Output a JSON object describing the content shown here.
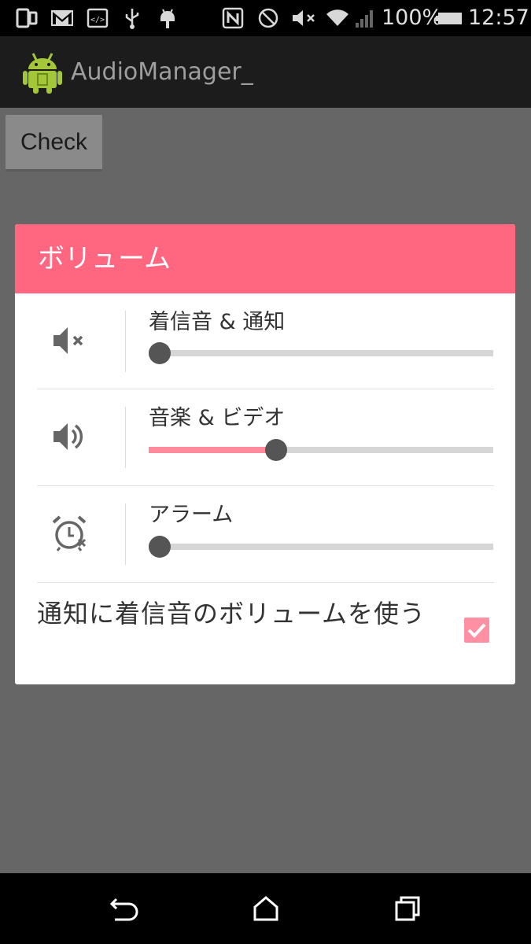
{
  "status_bar": {
    "battery_percent": "100%",
    "time": "12:57",
    "icons": [
      "tablet-icon",
      "gmail-icon",
      "code-icon",
      "usb-icon",
      "android-debug-icon",
      "nfc-icon",
      "block-icon",
      "mute-icon",
      "wifi-icon",
      "signal-icon",
      "battery-icon"
    ]
  },
  "action_bar": {
    "app_title": "AudioManager_",
    "app_icon": "android-app-icon"
  },
  "main": {
    "check_button": "Check"
  },
  "dialog": {
    "title": "ボリューム",
    "accent_color": "#ff6680",
    "rows": [
      {
        "label": "着信音 & 通知",
        "icon": "speaker-muted-icon",
        "level": 0.0
      },
      {
        "label": "音楽 & ビデオ",
        "icon": "speaker-volume-icon",
        "level": 0.35
      },
      {
        "label": "アラーム",
        "icon": "alarm-off-icon",
        "level": 0.0
      }
    ],
    "use_ringtone_volume": {
      "label": "通知に着信音のボリュームを使う",
      "checked": true
    }
  },
  "nav_bar": {
    "buttons": [
      "back-icon",
      "home-icon",
      "recents-icon"
    ]
  }
}
